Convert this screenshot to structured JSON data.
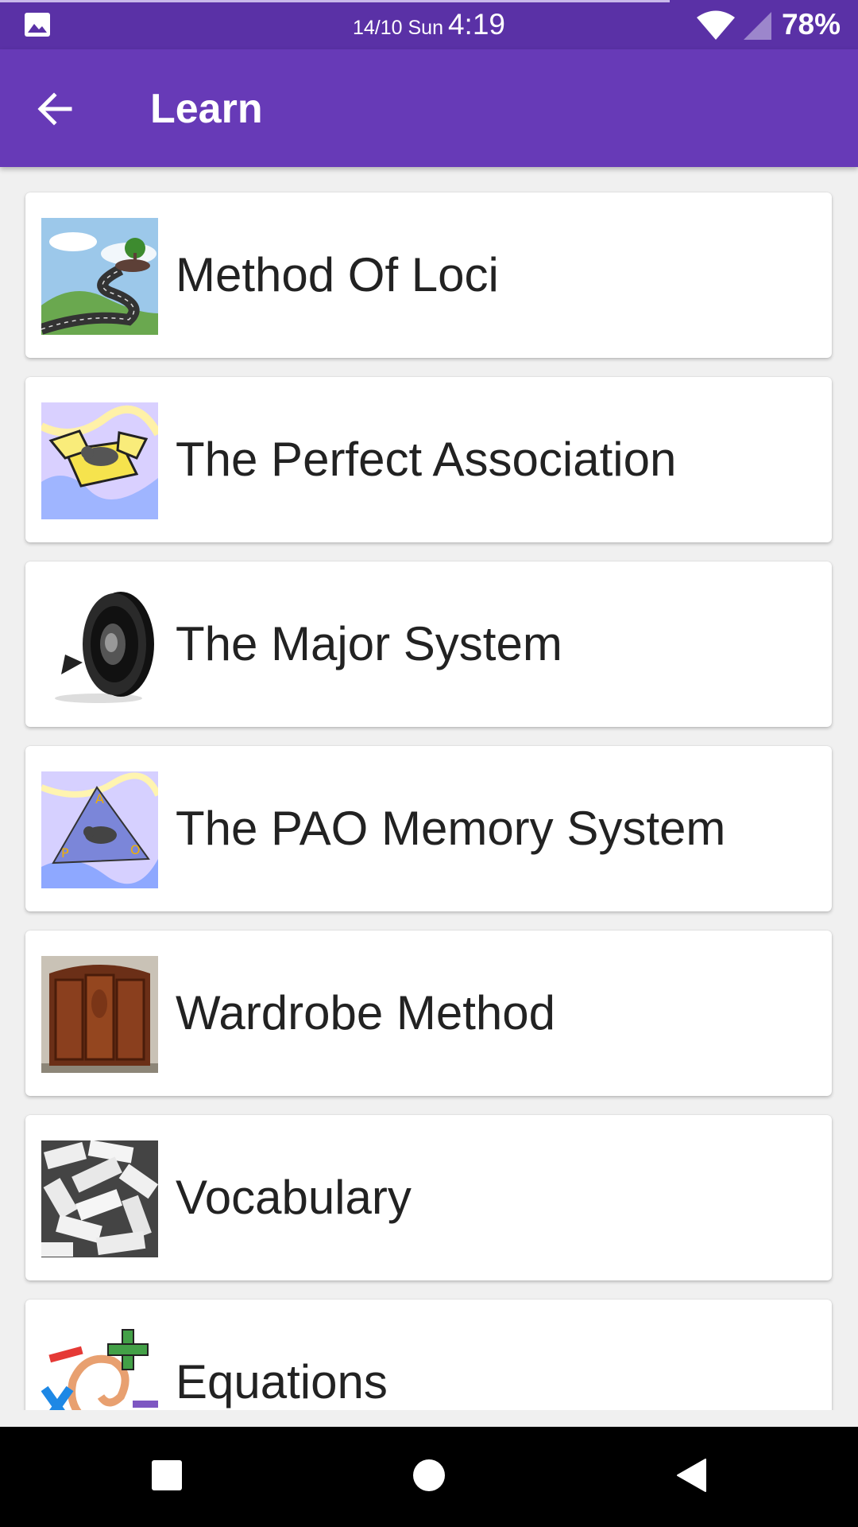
{
  "status_bar": {
    "date": "14/10 Sun",
    "time": "4:19",
    "battery": "78%",
    "icons": [
      "image-icon",
      "wifi-icon",
      "signal-icon"
    ]
  },
  "app_bar": {
    "title": "Learn",
    "back_icon": "arrow-back-icon"
  },
  "items": [
    {
      "label": "Method Of Loci",
      "icon": "winding-road-image"
    },
    {
      "label": "The Perfect Association",
      "icon": "box-elephant-image"
    },
    {
      "label": "The Major System",
      "icon": "speaker-image"
    },
    {
      "label": "The PAO Memory System",
      "icon": "pao-pyramid-image"
    },
    {
      "label": "Wardrobe Method",
      "icon": "wardrobe-image"
    },
    {
      "label": "Vocabulary",
      "icon": "word-clippings-image"
    },
    {
      "label": "Equations",
      "icon": "math-symbols-image"
    }
  ],
  "nav_bar": {
    "buttons": [
      "recents-square-icon",
      "home-circle-icon",
      "back-triangle-icon"
    ]
  },
  "colors": {
    "status_bar": "#5a31a6",
    "app_bar": "#673ab7",
    "background": "#f0f0f0",
    "card": "#ffffff",
    "nav_bar": "#000000"
  }
}
